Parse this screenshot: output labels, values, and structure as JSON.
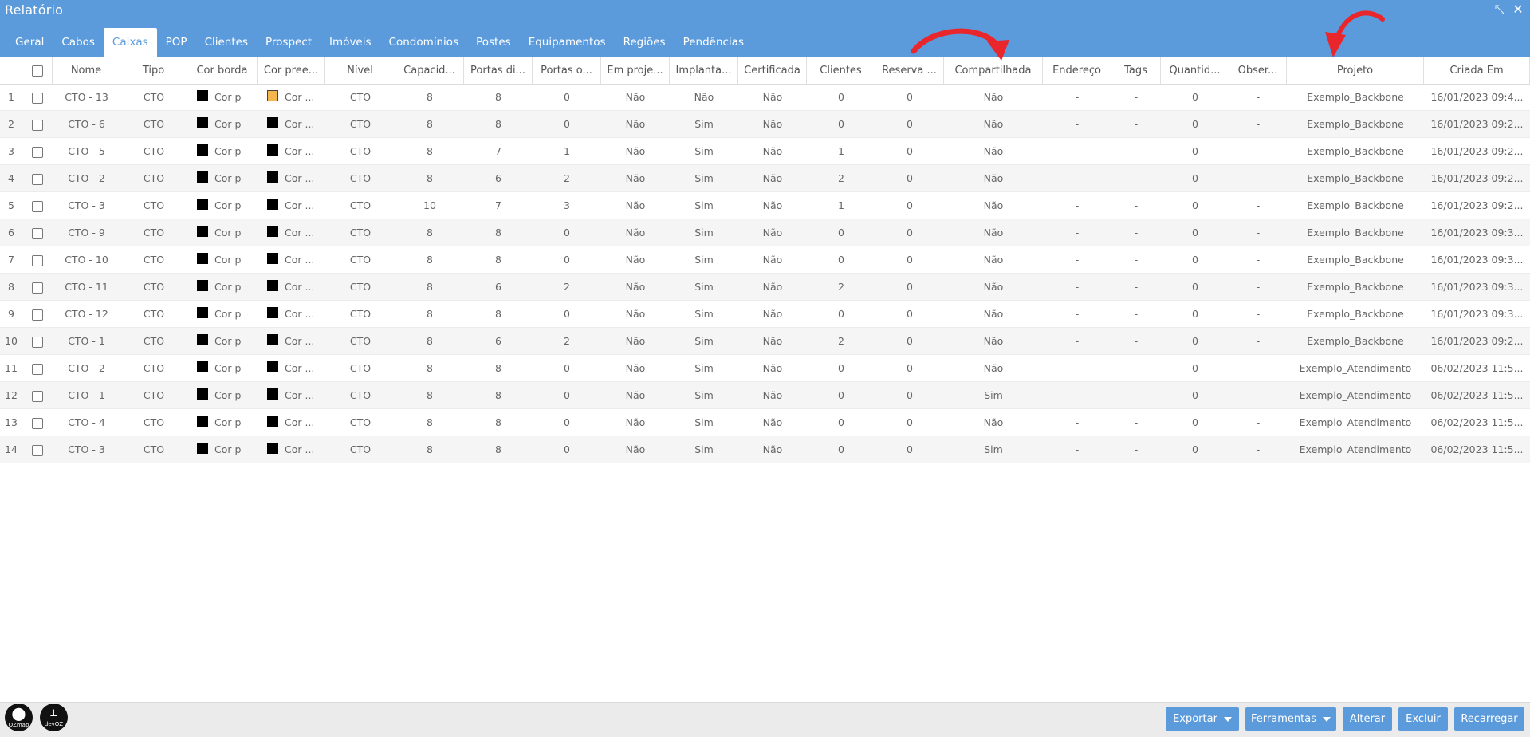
{
  "window": {
    "title": "Relatório"
  },
  "tabs": [
    "Geral",
    "Cabos",
    "Caixas",
    "POP",
    "Clientes",
    "Prospect",
    "Imóveis",
    "Condomínios",
    "Postes",
    "Equipamentos",
    "Regiões",
    "Pendências"
  ],
  "active_tab": "Caixas",
  "columns": [
    "Nome",
    "Tipo",
    "Cor borda",
    "Cor pree...",
    "Nível",
    "Capacid...",
    "Portas di...",
    "Portas o...",
    "Em proje...",
    "Implanta...",
    "Certificada",
    "Clientes",
    "Reserva ...",
    "Compartilhada",
    "Endereço",
    "Tags",
    "Quantid...",
    "Obser...",
    "Projeto",
    "Criada Em"
  ],
  "color_text": {
    "border": "Cor p",
    "fill": "Cor ..."
  },
  "colors": {
    "accent": "#5b9bdc",
    "swatch_black": "#000000",
    "swatch_orange": "#f6b64e",
    "annotation_arrow": "#e8262b"
  },
  "rows": [
    {
      "num": "1",
      "nome": "CTO - 13",
      "tipo": "CTO",
      "borda": "black",
      "preench": "orange",
      "nivel": "CTO",
      "cap": "8",
      "pdisp": "8",
      "pocup": "0",
      "proj": "Não",
      "impl": "Não",
      "cert": "Não",
      "cli": "0",
      "res": "0",
      "comp": "Não",
      "end": "-",
      "tags": "-",
      "qtd": "0",
      "obs": "-",
      "projeto": "Exemplo_Backbone",
      "criada": "16/01/2023 09:4..."
    },
    {
      "num": "2",
      "nome": "CTO - 6",
      "tipo": "CTO",
      "borda": "black",
      "preench": "black",
      "nivel": "CTO",
      "cap": "8",
      "pdisp": "8",
      "pocup": "0",
      "proj": "Não",
      "impl": "Sim",
      "cert": "Não",
      "cli": "0",
      "res": "0",
      "comp": "Não",
      "end": "-",
      "tags": "-",
      "qtd": "0",
      "obs": "-",
      "projeto": "Exemplo_Backbone",
      "criada": "16/01/2023 09:2..."
    },
    {
      "num": "3",
      "nome": "CTO - 5",
      "tipo": "CTO",
      "borda": "black",
      "preench": "black",
      "nivel": "CTO",
      "cap": "8",
      "pdisp": "7",
      "pocup": "1",
      "proj": "Não",
      "impl": "Sim",
      "cert": "Não",
      "cli": "1",
      "res": "0",
      "comp": "Não",
      "end": "-",
      "tags": "-",
      "qtd": "0",
      "obs": "-",
      "projeto": "Exemplo_Backbone",
      "criada": "16/01/2023 09:2..."
    },
    {
      "num": "4",
      "nome": "CTO - 2",
      "tipo": "CTO",
      "borda": "black",
      "preench": "black",
      "nivel": "CTO",
      "cap": "8",
      "pdisp": "6",
      "pocup": "2",
      "proj": "Não",
      "impl": "Sim",
      "cert": "Não",
      "cli": "2",
      "res": "0",
      "comp": "Não",
      "end": "-",
      "tags": "-",
      "qtd": "0",
      "obs": "-",
      "projeto": "Exemplo_Backbone",
      "criada": "16/01/2023 09:2..."
    },
    {
      "num": "5",
      "nome": "CTO - 3",
      "tipo": "CTO",
      "borda": "black",
      "preench": "black",
      "nivel": "CTO",
      "cap": "10",
      "pdisp": "7",
      "pocup": "3",
      "proj": "Não",
      "impl": "Sim",
      "cert": "Não",
      "cli": "1",
      "res": "0",
      "comp": "Não",
      "end": "-",
      "tags": "-",
      "qtd": "0",
      "obs": "-",
      "projeto": "Exemplo_Backbone",
      "criada": "16/01/2023 09:2..."
    },
    {
      "num": "6",
      "nome": "CTO - 9",
      "tipo": "CTO",
      "borda": "black",
      "preench": "black",
      "nivel": "CTO",
      "cap": "8",
      "pdisp": "8",
      "pocup": "0",
      "proj": "Não",
      "impl": "Sim",
      "cert": "Não",
      "cli": "0",
      "res": "0",
      "comp": "Não",
      "end": "-",
      "tags": "-",
      "qtd": "0",
      "obs": "-",
      "projeto": "Exemplo_Backbone",
      "criada": "16/01/2023 09:3..."
    },
    {
      "num": "7",
      "nome": "CTO - 10",
      "tipo": "CTO",
      "borda": "black",
      "preench": "black",
      "nivel": "CTO",
      "cap": "8",
      "pdisp": "8",
      "pocup": "0",
      "proj": "Não",
      "impl": "Sim",
      "cert": "Não",
      "cli": "0",
      "res": "0",
      "comp": "Não",
      "end": "-",
      "tags": "-",
      "qtd": "0",
      "obs": "-",
      "projeto": "Exemplo_Backbone",
      "criada": "16/01/2023 09:3..."
    },
    {
      "num": "8",
      "nome": "CTO - 11",
      "tipo": "CTO",
      "borda": "black",
      "preench": "black",
      "nivel": "CTO",
      "cap": "8",
      "pdisp": "6",
      "pocup": "2",
      "proj": "Não",
      "impl": "Sim",
      "cert": "Não",
      "cli": "2",
      "res": "0",
      "comp": "Não",
      "end": "-",
      "tags": "-",
      "qtd": "0",
      "obs": "-",
      "projeto": "Exemplo_Backbone",
      "criada": "16/01/2023 09:3..."
    },
    {
      "num": "9",
      "nome": "CTO - 12",
      "tipo": "CTO",
      "borda": "black",
      "preench": "black",
      "nivel": "CTO",
      "cap": "8",
      "pdisp": "8",
      "pocup": "0",
      "proj": "Não",
      "impl": "Sim",
      "cert": "Não",
      "cli": "0",
      "res": "0",
      "comp": "Não",
      "end": "-",
      "tags": "-",
      "qtd": "0",
      "obs": "-",
      "projeto": "Exemplo_Backbone",
      "criada": "16/01/2023 09:3..."
    },
    {
      "num": "10",
      "nome": "CTO - 1",
      "tipo": "CTO",
      "borda": "black",
      "preench": "black",
      "nivel": "CTO",
      "cap": "8",
      "pdisp": "6",
      "pocup": "2",
      "proj": "Não",
      "impl": "Sim",
      "cert": "Não",
      "cli": "2",
      "res": "0",
      "comp": "Não",
      "end": "-",
      "tags": "-",
      "qtd": "0",
      "obs": "-",
      "projeto": "Exemplo_Backbone",
      "criada": "16/01/2023 09:2..."
    },
    {
      "num": "11",
      "nome": "CTO - 2",
      "tipo": "CTO",
      "borda": "black",
      "preench": "black",
      "nivel": "CTO",
      "cap": "8",
      "pdisp": "8",
      "pocup": "0",
      "proj": "Não",
      "impl": "Sim",
      "cert": "Não",
      "cli": "0",
      "res": "0",
      "comp": "Não",
      "end": "-",
      "tags": "-",
      "qtd": "0",
      "obs": "-",
      "projeto": "Exemplo_Atendimento",
      "criada": "06/02/2023 11:5..."
    },
    {
      "num": "12",
      "nome": "CTO - 1",
      "tipo": "CTO",
      "borda": "black",
      "preench": "black",
      "nivel": "CTO",
      "cap": "8",
      "pdisp": "8",
      "pocup": "0",
      "proj": "Não",
      "impl": "Sim",
      "cert": "Não",
      "cli": "0",
      "res": "0",
      "comp": "Sim",
      "end": "-",
      "tags": "-",
      "qtd": "0",
      "obs": "-",
      "projeto": "Exemplo_Atendimento",
      "criada": "06/02/2023 11:5..."
    },
    {
      "num": "13",
      "nome": "CTO - 4",
      "tipo": "CTO",
      "borda": "black",
      "preench": "black",
      "nivel": "CTO",
      "cap": "8",
      "pdisp": "8",
      "pocup": "0",
      "proj": "Não",
      "impl": "Sim",
      "cert": "Não",
      "cli": "0",
      "res": "0",
      "comp": "Não",
      "end": "-",
      "tags": "-",
      "qtd": "0",
      "obs": "-",
      "projeto": "Exemplo_Atendimento",
      "criada": "06/02/2023 11:5..."
    },
    {
      "num": "14",
      "nome": "CTO - 3",
      "tipo": "CTO",
      "borda": "black",
      "preench": "black",
      "nivel": "CTO",
      "cap": "8",
      "pdisp": "8",
      "pocup": "0",
      "proj": "Não",
      "impl": "Sim",
      "cert": "Não",
      "cli": "0",
      "res": "0",
      "comp": "Sim",
      "end": "-",
      "tags": "-",
      "qtd": "0",
      "obs": "-",
      "projeto": "Exemplo_Atendimento",
      "criada": "06/02/2023 11:5..."
    }
  ],
  "footer": {
    "logos": [
      {
        "caption": "OZmap"
      },
      {
        "caption": "devOZ"
      }
    ],
    "buttons": [
      "Exportar",
      "Ferramentas",
      "Alterar",
      "Excluir",
      "Recarregar"
    ]
  }
}
